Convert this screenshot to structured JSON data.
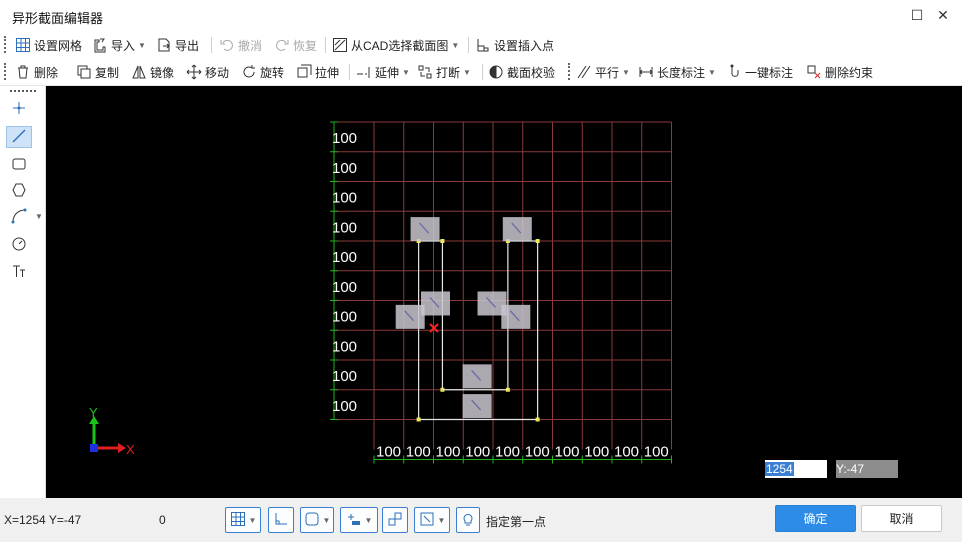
{
  "window": {
    "title": "异形截面编辑器",
    "maximize_icon": "maximize-icon",
    "close_icon": "close-icon"
  },
  "toolbar1": {
    "set_grid": "设置网格",
    "import": "导入",
    "export": "导出",
    "undo": "撤消",
    "redo": "恢复",
    "from_cad": "从CAD选择截面图",
    "set_insert_point": "设置插入点"
  },
  "toolbar2": {
    "delete": "删除",
    "copy": "复制",
    "mirror": "镜像",
    "move": "移动",
    "rotate": "旋转",
    "stretch": "拉伸",
    "extend": "延伸",
    "break": "打断",
    "section_check": "截面校验",
    "parallel": "平行",
    "length_dim": "长度标注",
    "one_click_dim": "一键标注",
    "delete_constraint": "删除约束"
  },
  "canvas": {
    "grid_label": "100",
    "x_input_value": "1254",
    "y_input_value": "Y:-47",
    "axis_x": "X",
    "axis_y": "Y"
  },
  "status": {
    "coords": "X=1254 Y=-47",
    "count": "0",
    "hint": "指定第一点",
    "ok": "确定",
    "cancel": "取消"
  },
  "colors": {
    "grid": "#8a3a3a",
    "axis": "#1db41d",
    "section": "#e6e6e6",
    "accent": "#2d8ce8"
  }
}
